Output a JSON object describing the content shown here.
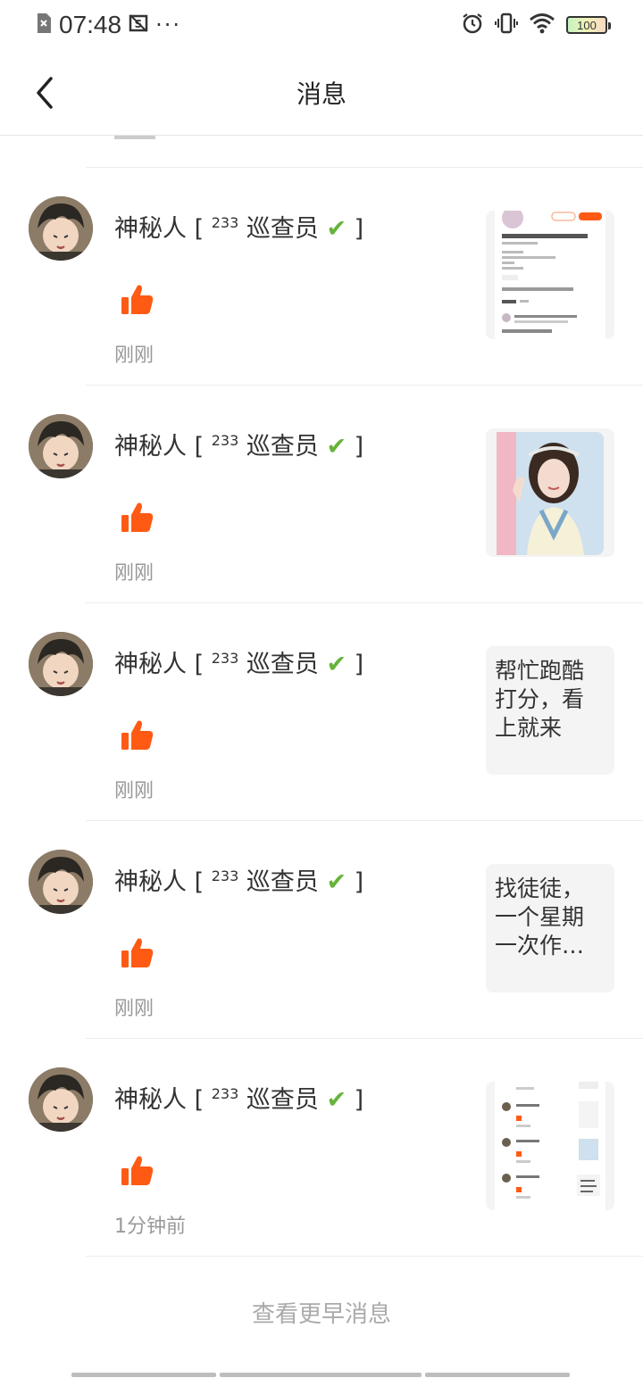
{
  "status_bar": {
    "time": "07:48",
    "dots": "···",
    "battery": "100",
    "icons": [
      "sim-off-icon",
      "screenshot-icon",
      "alarm-icon",
      "vibrate-icon",
      "wifi-icon",
      "battery-icon"
    ]
  },
  "header": {
    "title": "消息",
    "back_icon": "chevron-left-icon"
  },
  "messages": [
    {
      "user": "神秘人",
      "badge_sup": "233",
      "badge_text": "巡查员",
      "badge_check": "✔",
      "action_icon": "thumbs-up-icon",
      "time": "刚刚",
      "thumb_type": "screenshot-profile",
      "thumb_text": ""
    },
    {
      "user": "神秘人",
      "badge_sup": "233",
      "badge_text": "巡查员",
      "badge_check": "✔",
      "action_icon": "thumbs-up-icon",
      "time": "刚刚",
      "thumb_type": "photo",
      "thumb_text": ""
    },
    {
      "user": "神秘人",
      "badge_sup": "233",
      "badge_text": "巡查员",
      "badge_check": "✔",
      "action_icon": "thumbs-up-icon",
      "time": "刚刚",
      "thumb_type": "text",
      "thumb_text": "帮忙跑酷打分，看上就来"
    },
    {
      "user": "神秘人",
      "badge_sup": "233",
      "badge_text": "巡查员",
      "badge_check": "✔",
      "action_icon": "thumbs-up-icon",
      "time": "刚刚",
      "thumb_type": "text",
      "thumb_text": "找徒徒，一个星期一次作…"
    },
    {
      "user": "神秘人",
      "badge_sup": "233",
      "badge_text": "巡查员",
      "badge_check": "✔",
      "action_icon": "thumbs-up-icon",
      "time": "1分钟前",
      "thumb_type": "screenshot-list",
      "thumb_text": ""
    }
  ],
  "footer": {
    "more_label": "查看更早消息"
  },
  "colors": {
    "accent": "#ff5a14",
    "check": "#67b33b",
    "muted": "#999999"
  }
}
